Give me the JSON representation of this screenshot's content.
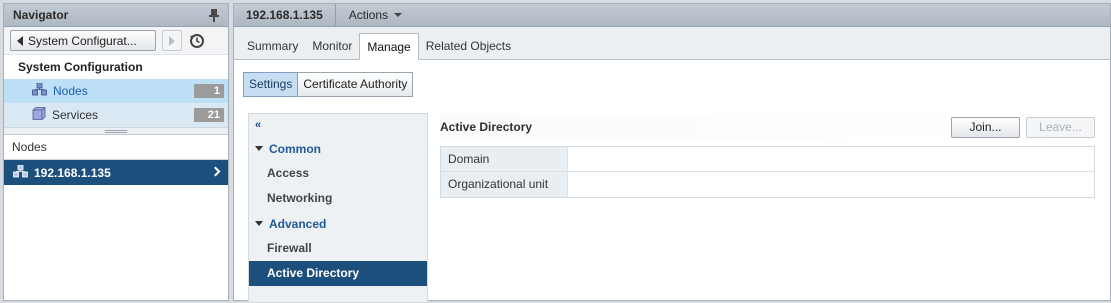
{
  "navigator": {
    "title": "Navigator",
    "back_label": "System Configurat...",
    "section_title": "System Configuration",
    "items": [
      {
        "label": "Nodes",
        "count": "1"
      },
      {
        "label": "Services",
        "count": "21"
      }
    ],
    "nodes_header": "Nodes",
    "node": "192.168.1.135"
  },
  "main": {
    "object_title": "192.168.1.135",
    "actions_label": "Actions",
    "tabs": [
      "Summary",
      "Monitor",
      "Manage",
      "Related Objects"
    ],
    "active_tab": "Manage",
    "subtabs": [
      "Settings",
      "Certificate Authority"
    ],
    "side": {
      "collapse": "«",
      "sections": [
        {
          "label": "Common",
          "items": [
            "Access",
            "Networking"
          ]
        },
        {
          "label": "Advanced",
          "items": [
            "Firewall",
            "Active Directory"
          ]
        }
      ],
      "selected": "Active Directory"
    },
    "content": {
      "title": "Active Directory",
      "join_label": "Join...",
      "leave_label": "Leave...",
      "rows": [
        {
          "key": "Domain",
          "value": ""
        },
        {
          "key": "Organizational unit",
          "value": ""
        }
      ]
    }
  },
  "colors": {
    "selection": "#1d4f7d",
    "highlight": "#bde0f7",
    "badge": "#9b9b9b"
  }
}
